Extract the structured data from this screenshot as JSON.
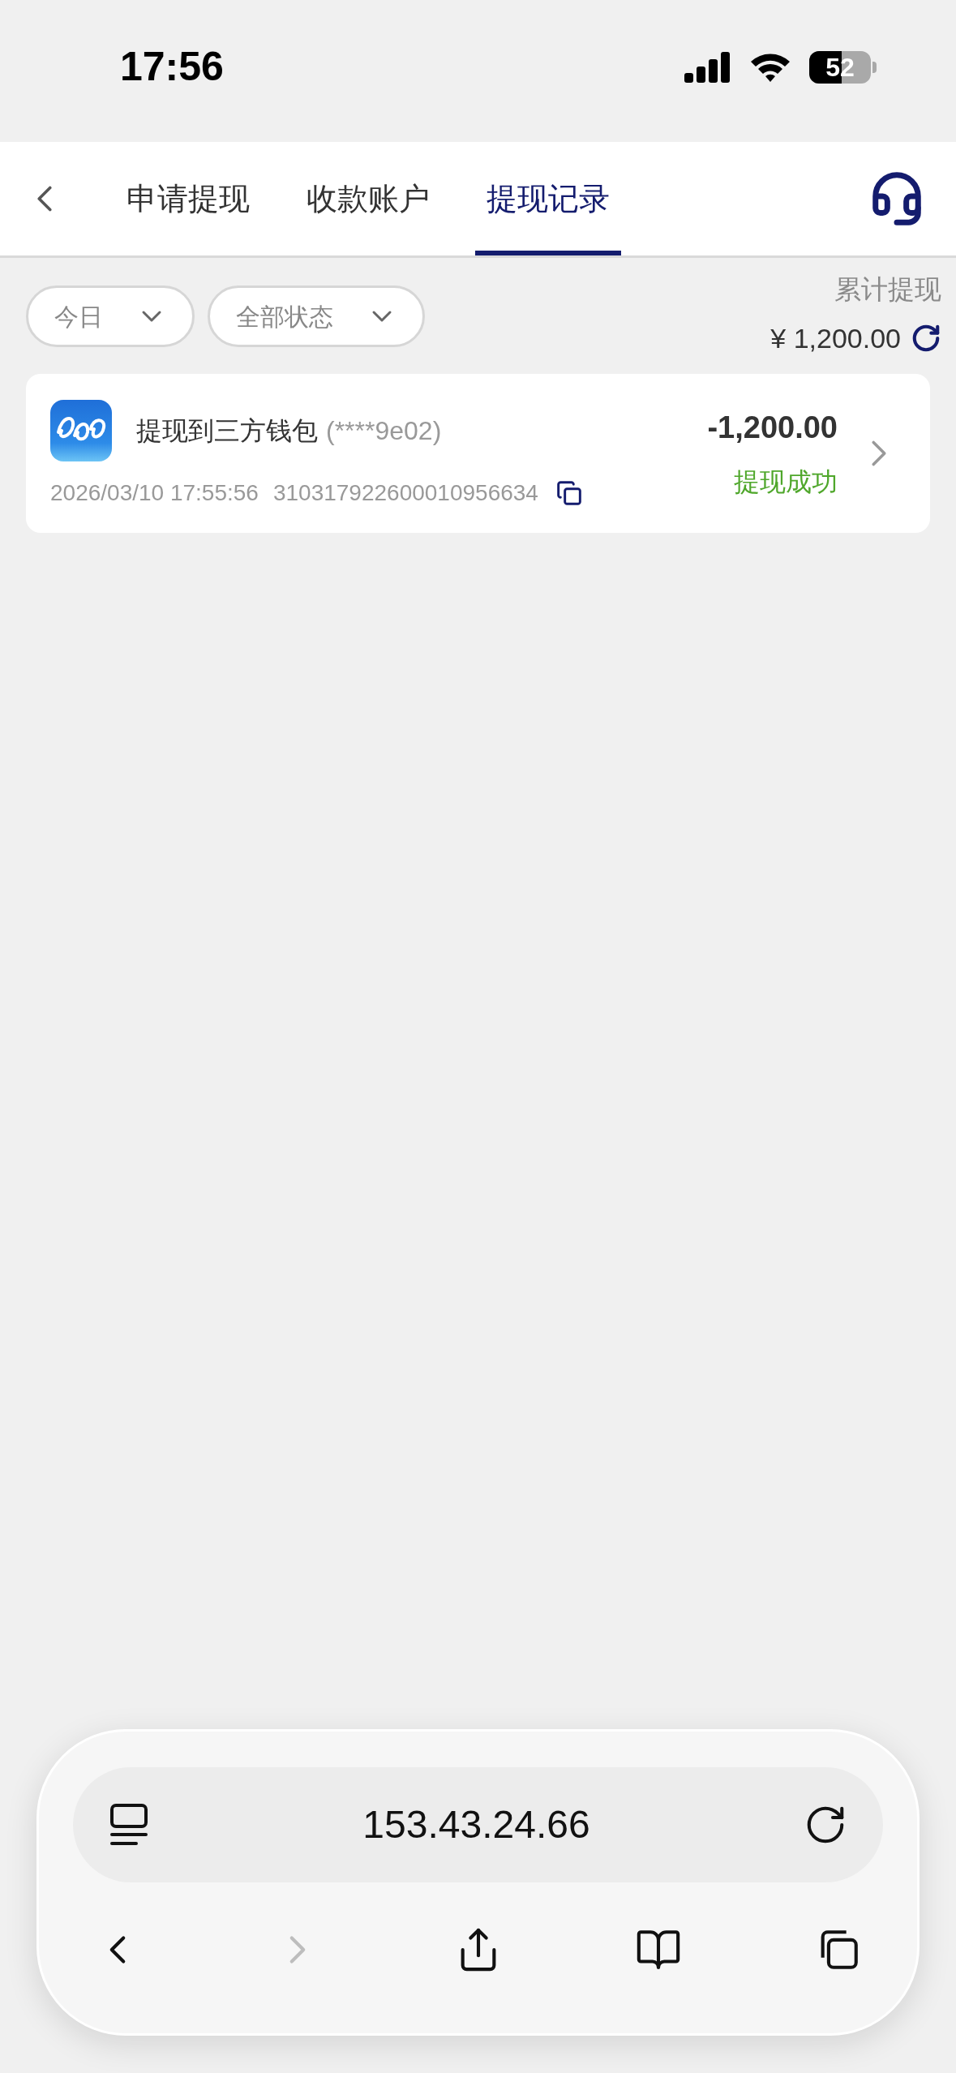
{
  "status_bar": {
    "time": "17:56",
    "battery": "52"
  },
  "tabs": [
    {
      "label": "申请提现",
      "selected": false
    },
    {
      "label": "收款账户",
      "selected": false
    },
    {
      "label": "提现记录",
      "selected": true
    }
  ],
  "filters": [
    {
      "label": "今日"
    },
    {
      "label": "全部状态"
    }
  ],
  "summary": {
    "label": "累计提现",
    "amount": "¥ 1,200.00"
  },
  "records": [
    {
      "title": "提现到三方钱包",
      "account": "(****9e02)",
      "time": "2026/03/10 17:55:56",
      "order_no": "310317922600010956634",
      "amount": "-1,200.00",
      "status": {
        "text": "提现成功",
        "kind": "success"
      }
    }
  ],
  "browser": {
    "url": "153.43.24.66",
    "nav": [
      {
        "kind": "back",
        "disabled": false
      },
      {
        "kind": "forward",
        "disabled": true
      },
      {
        "kind": "share",
        "disabled": false
      },
      {
        "kind": "bookmarks",
        "disabled": false
      },
      {
        "kind": "tabs",
        "disabled": false
      }
    ]
  }
}
